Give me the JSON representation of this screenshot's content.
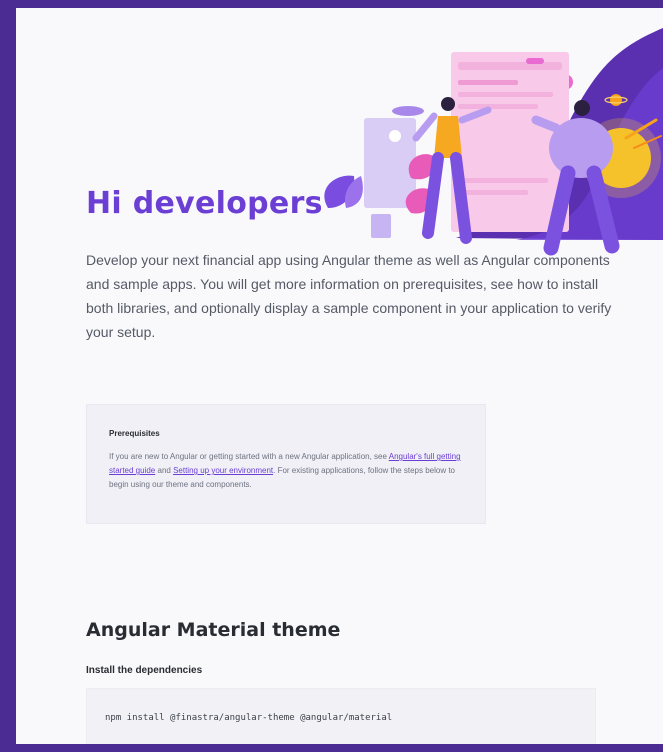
{
  "hero": {
    "title": "Hi developers",
    "intro": "Develop your next financial app using Angular theme as well as Angular components and sample apps. You will get more information on prerequisites, see how to install both libraries, and optionally display a sample component in your application to verify your setup.",
    "illustration_icon": "developers-illustration-icon",
    "code_badge": "</>"
  },
  "prerequisites": {
    "heading": "Prerequisites",
    "text_before": "If you are new to Angular or getting started with a new Angular application, see ",
    "link1": "Angular's full getting started guide",
    "text_mid": " and ",
    "link2": "Setting up your environment",
    "text_after": ". For existing applications, follow the steps below to begin using our theme and components."
  },
  "section": {
    "title": "Angular Material theme",
    "subtitle": "Install the dependencies",
    "code": "npm install @finastra/angular-theme @angular/material"
  },
  "colors": {
    "frame": "#4b2c93",
    "accent": "#6b3fd4",
    "page_bg": "#f9f9fb"
  }
}
